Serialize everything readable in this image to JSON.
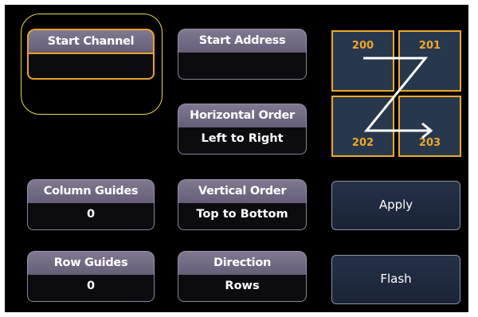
{
  "fields": {
    "start_channel": {
      "label": "Start Channel",
      "value": ""
    },
    "start_address": {
      "label": "Start Address",
      "value": ""
    },
    "horizontal_order": {
      "label": "Horizontal Order",
      "value": "Left to Right"
    },
    "column_guides": {
      "label": "Column Guides",
      "value": "0"
    },
    "vertical_order": {
      "label": "Vertical Order",
      "value": "Top to Bottom"
    },
    "row_guides": {
      "label": "Row Guides",
      "value": "0"
    },
    "direction": {
      "label": "Direction",
      "value": "Rows"
    }
  },
  "preview": {
    "cells": [
      "200",
      "201",
      "202",
      "203"
    ]
  },
  "buttons": {
    "apply": "Apply",
    "flash": "Flash"
  },
  "colors": {
    "selection": "#e7a32a",
    "highlight_ring": "#e6dd4a",
    "cell_fill": "#27384d",
    "cell_border": "#f0a828"
  }
}
